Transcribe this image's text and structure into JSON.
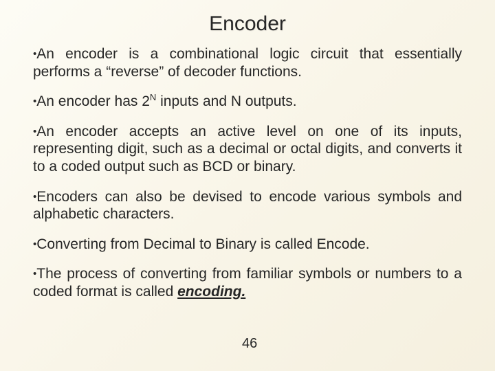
{
  "title": "Encoder",
  "bullets": {
    "b1": "An encoder is a combinational logic circuit that essentially performs a “reverse” of decoder functions.",
    "b2_pre": "An encoder has 2",
    "b2_sup": "N",
    "b2_post": " inputs and N outputs.",
    "b3": "An encoder accepts an active level on one of its inputs, representing  digit, such as a decimal or octal digits, and converts it to a coded output such as BCD or binary.",
    "b4": "Encoders can also be devised to encode various symbols and alphabetic characters.",
    "b5": "Converting from Decimal to Binary is called Encode.",
    "b6_pre": "The process of converting from familiar symbols or numbers to a coded format is called ",
    "b6_em": "encoding."
  },
  "page_number": "46"
}
